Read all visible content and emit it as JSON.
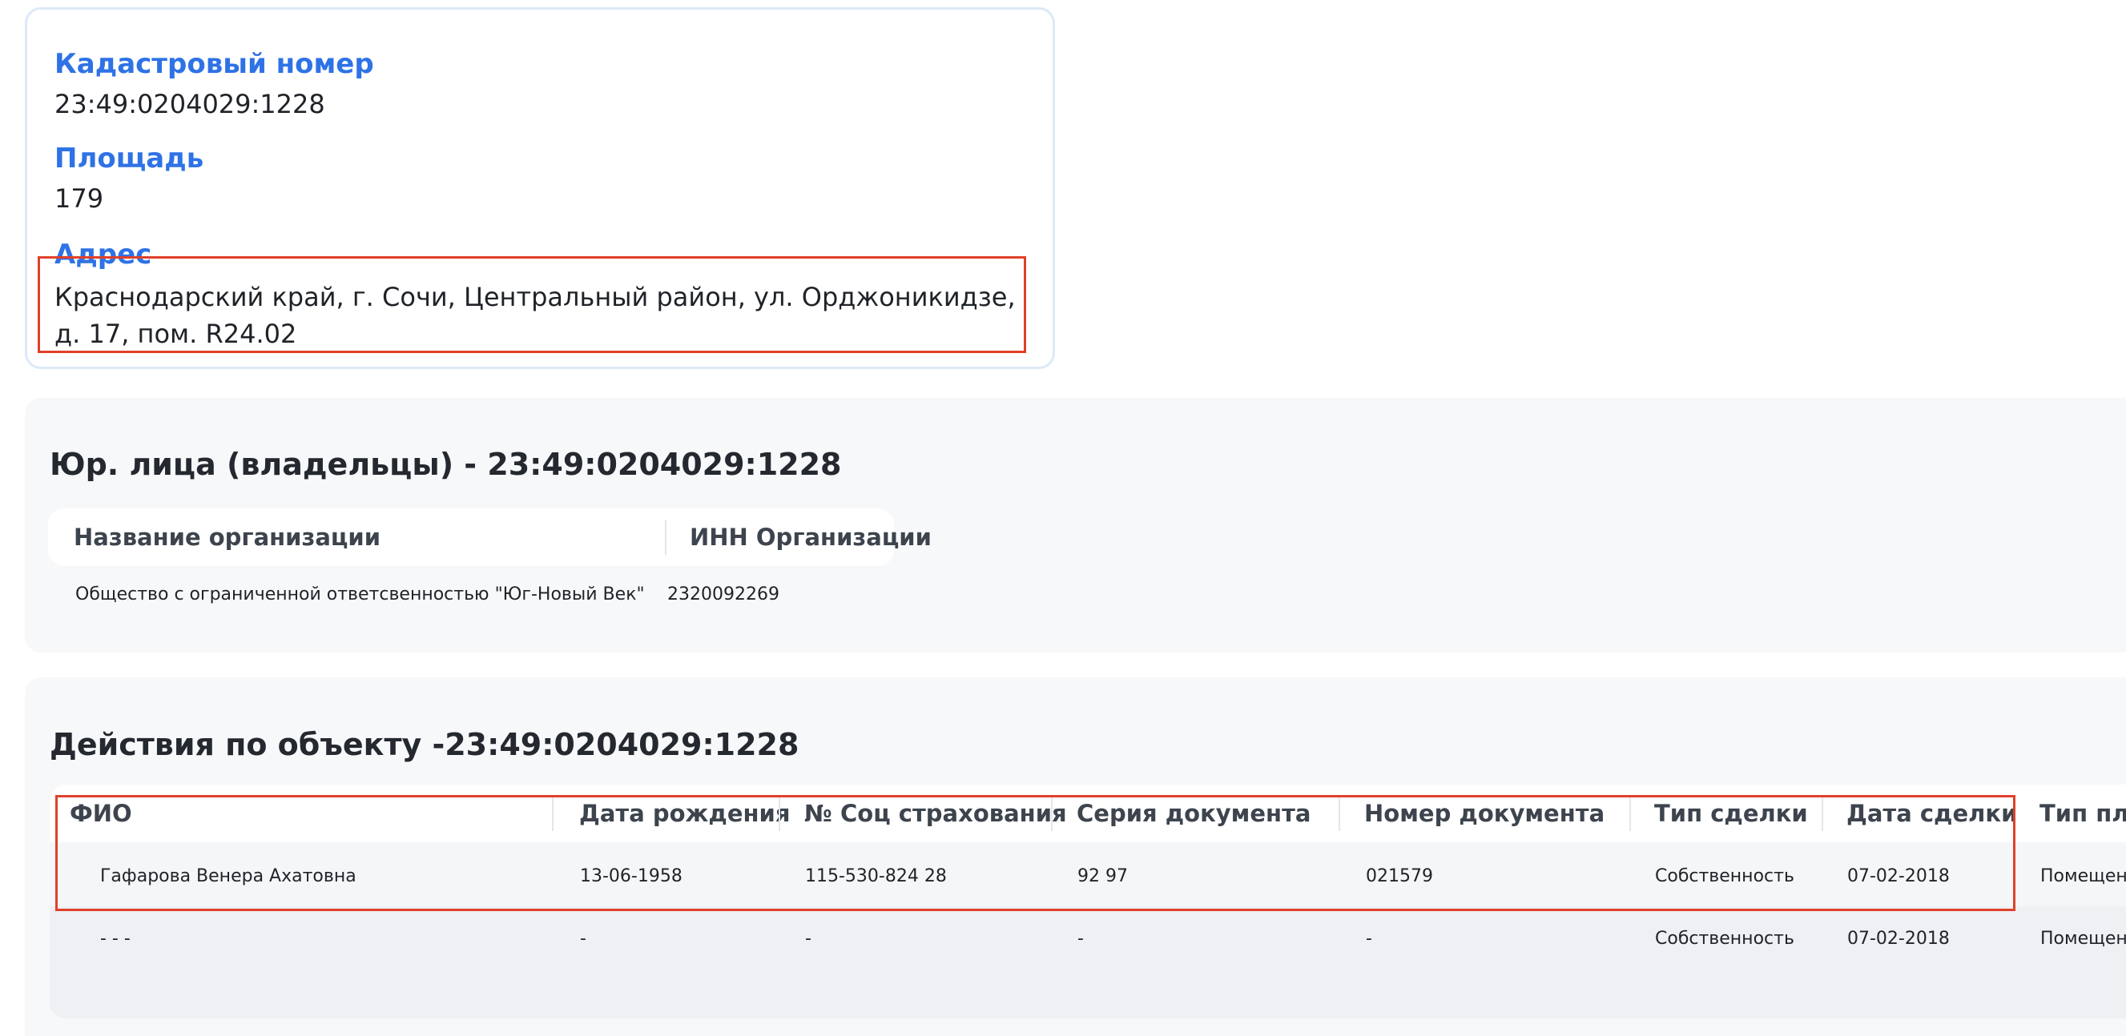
{
  "object": {
    "cadastral_label": "Кадастровый номер",
    "cadastral_value": "23:49:0204029:1228",
    "area_label": "Площадь",
    "area_value": "179",
    "address_label": "Адрес",
    "address_value": "Краснодарский край, г. Сочи, Центральный район, ул. Орджоникидзе, д. 17, пом. R24.02"
  },
  "owners": {
    "title": "Юр. лица (владельцы) - 23:49:0204029:1228",
    "columns": [
      "Название организации",
      "ИНН Организации"
    ],
    "rows": [
      [
        "Общество с ограниченной ответсвенностью \"Юг-Новый Век\"",
        "2320092269"
      ]
    ]
  },
  "actions": {
    "title": "Действия по объекту -23:49:0204029:1228",
    "columns": [
      "ФИО",
      "Дата рождения",
      "№ Соц страхования",
      "Серия документа",
      "Номер документа",
      "Тип сделки",
      "Дата сделки",
      "Тип пло"
    ],
    "rows": [
      [
        "Гафарова Венера Ахатовна",
        "13-06-1958",
        "115-530-824 28",
        "92 97",
        "021579",
        "Собственность",
        "07-02-2018",
        "Помещени"
      ],
      [
        "- - -",
        "-",
        "-",
        "-",
        "-",
        "Собственность",
        "07-02-2018",
        "Помещени"
      ]
    ]
  },
  "colors": {
    "label_blue": "#2e72e6",
    "highlight_red": "#e0402a"
  }
}
